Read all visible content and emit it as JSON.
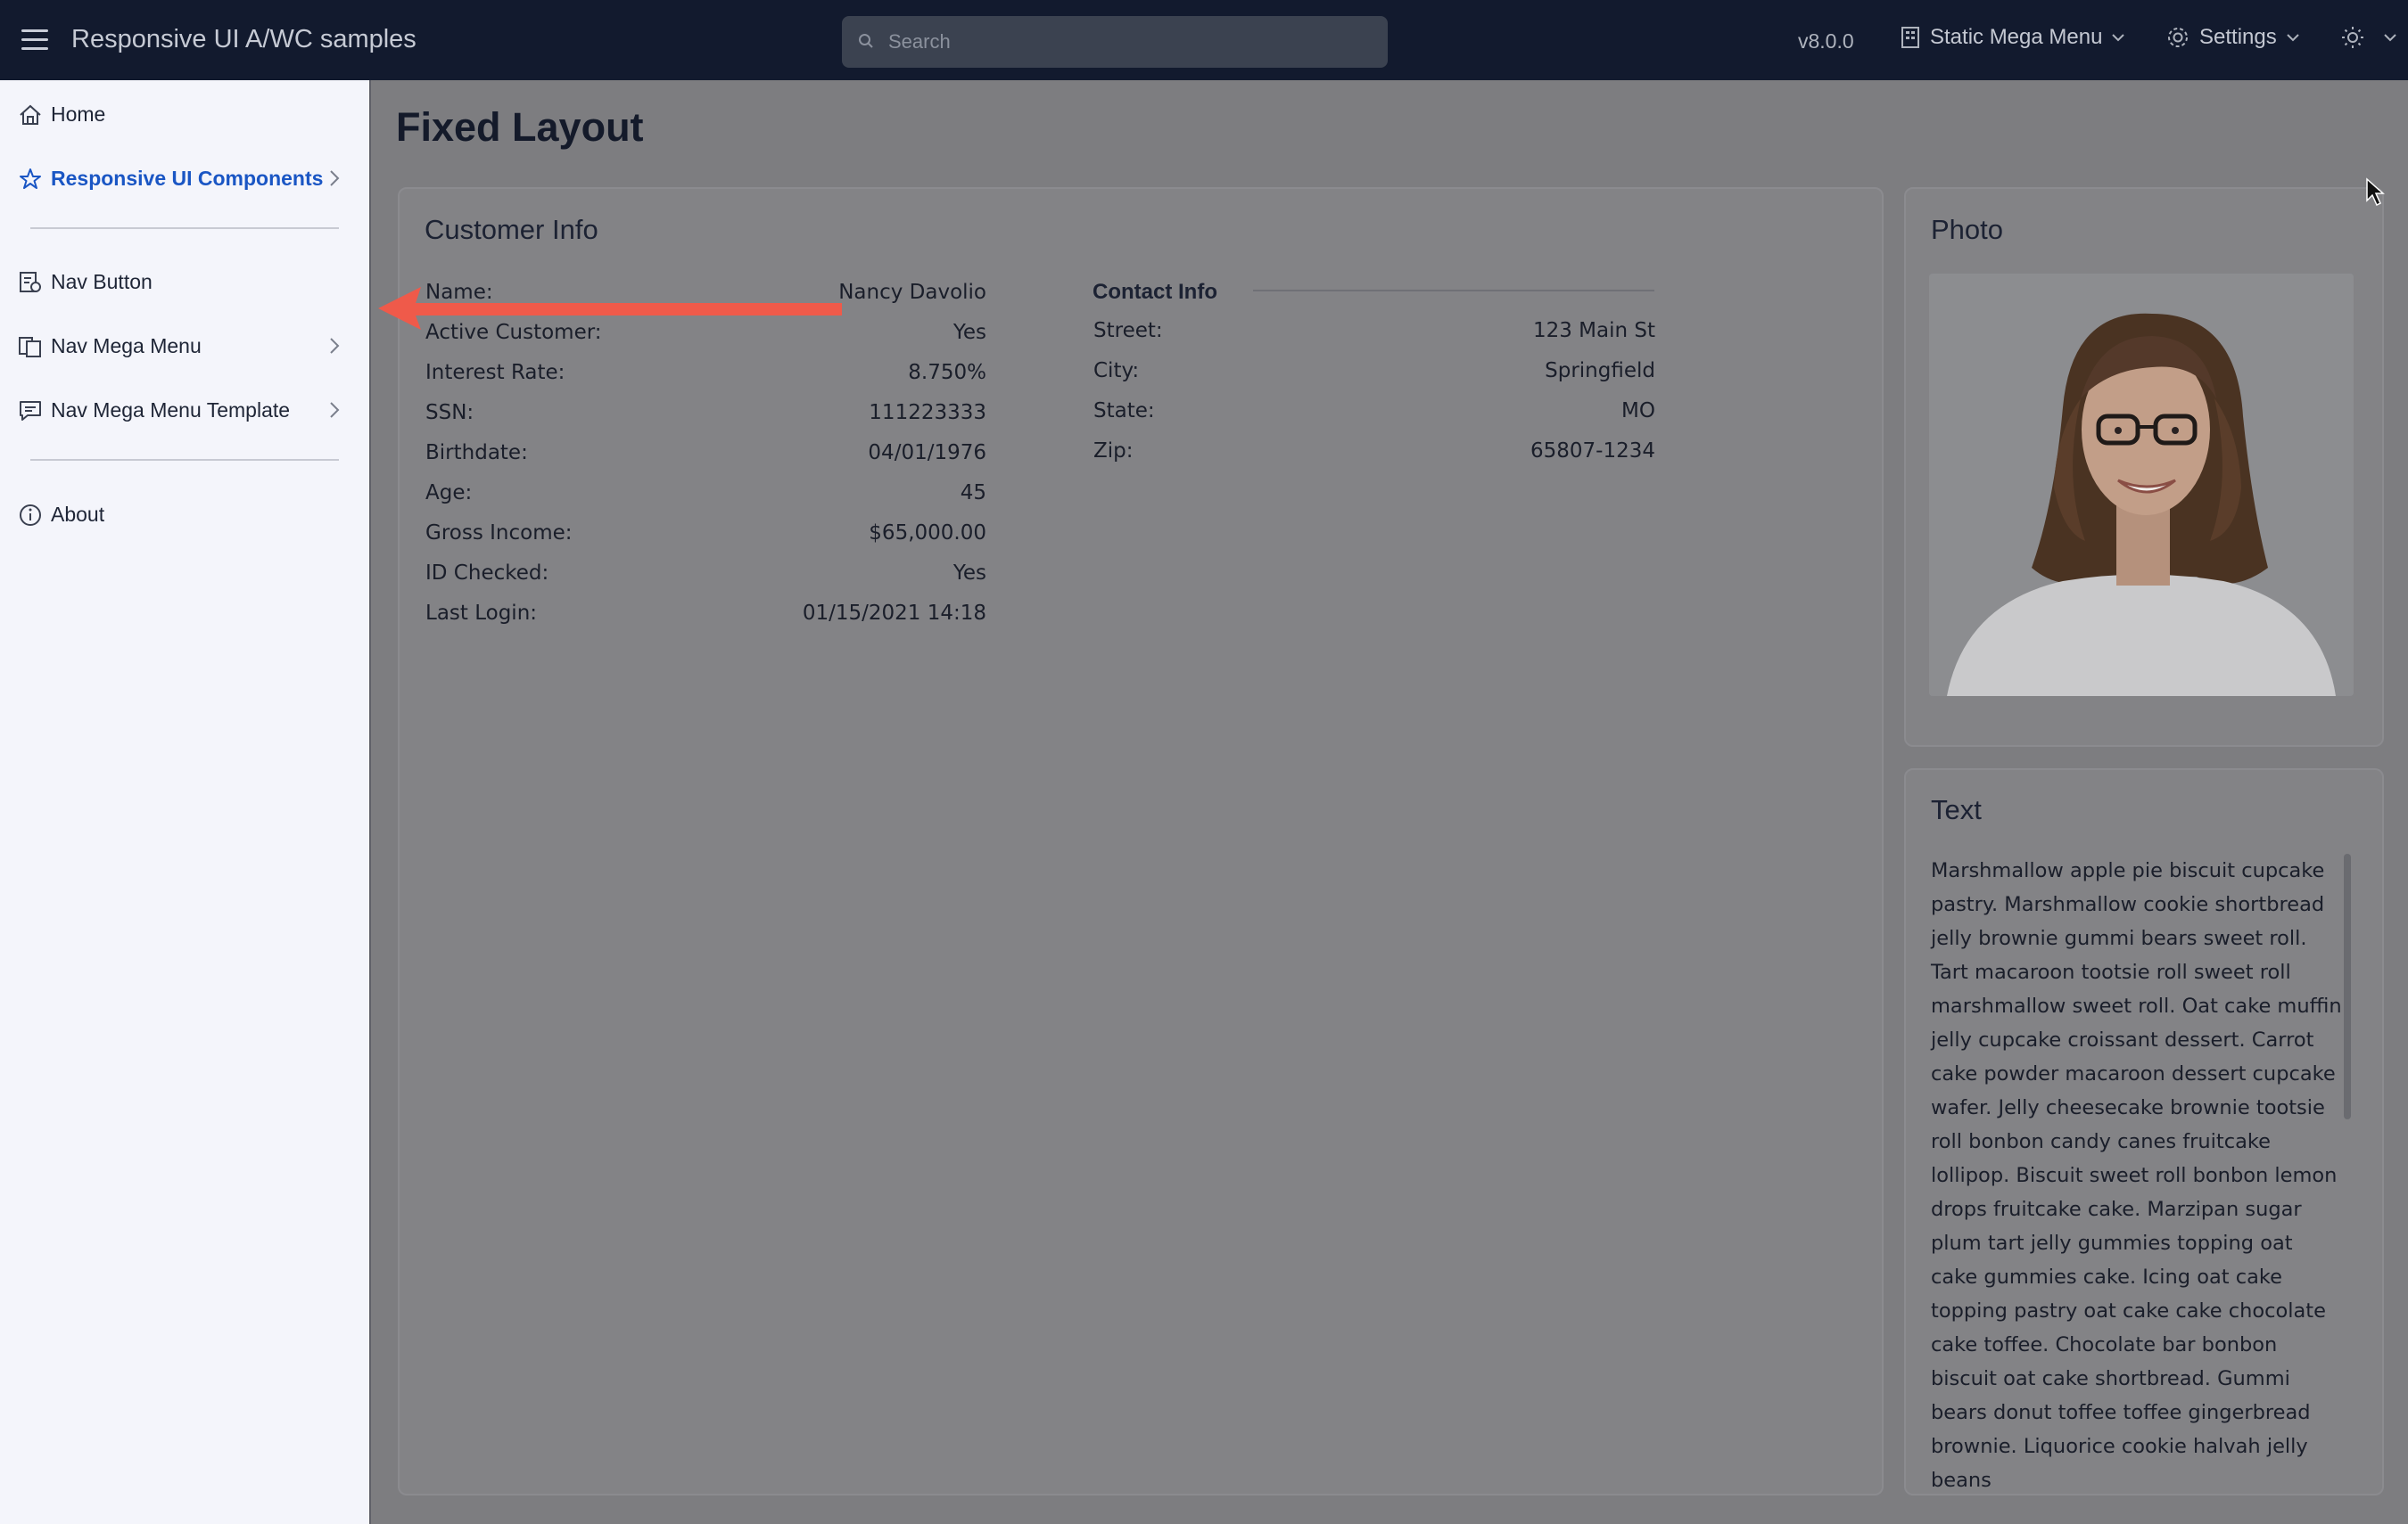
{
  "topbar": {
    "app_title": "Responsive UI A/WC samples",
    "search_placeholder": "Search",
    "version": "v8.0.0",
    "mega_menu_label": "Static Mega Menu",
    "settings_label": "Settings"
  },
  "sidebar": {
    "items": [
      {
        "label": "Home",
        "icon": "home-icon"
      },
      {
        "label": "Responsive UI Components",
        "icon": "star-icon",
        "active": true
      },
      {
        "label": "Nav Button",
        "icon": "nav-button-icon"
      },
      {
        "label": "Nav Mega Menu",
        "icon": "mega-menu-icon"
      },
      {
        "label": "Nav Mega Menu Template",
        "icon": "chat-icon"
      },
      {
        "label": "About",
        "icon": "info-icon"
      }
    ]
  },
  "page": {
    "title": "Fixed Layout"
  },
  "customer_info": {
    "title": "Customer Info",
    "rows": [
      {
        "label": "Name:",
        "value": "Nancy Davolio"
      },
      {
        "label": "Active Customer:",
        "value": "Yes"
      },
      {
        "label": "Interest Rate:",
        "value": "8.750%"
      },
      {
        "label": "SSN:",
        "value": "111223333"
      },
      {
        "label": "Birthdate:",
        "value": "04/01/1976"
      },
      {
        "label": "Age:",
        "value": "45"
      },
      {
        "label": "Gross Income:",
        "value": "$65,000.00"
      },
      {
        "label": "ID Checked:",
        "value": "Yes"
      },
      {
        "label": "Last Login:",
        "value": "01/15/2021 14:18"
      }
    ],
    "contact_title": "Contact Info",
    "contact_rows": [
      {
        "label": "Street:",
        "value": "123 Main St"
      },
      {
        "label": "City:",
        "value": "Springfield"
      },
      {
        "label": "State:",
        "value": "MO"
      },
      {
        "label": "Zip:",
        "value": "65807-1234"
      }
    ]
  },
  "photo_card": {
    "title": "Photo"
  },
  "text_card": {
    "title": "Text",
    "body": "Marshmallow apple pie biscuit cupcake pastry. Marshmallow cookie shortbread jelly brownie gummi bears sweet roll. Tart macaroon tootsie roll sweet roll marshmallow sweet roll. Oat cake muffin jelly cupcake croissant dessert. Carrot cake powder macaroon dessert cupcake wafer. Jelly cheesecake brownie tootsie roll bonbon candy canes fruitcake lollipop. Biscuit sweet roll bonbon lemon drops fruitcake cake. Marzipan sugar plum tart jelly gummies topping oat cake gummies cake. Icing oat cake topping pastry oat cake cake chocolate cake toffee. Chocolate bar bonbon biscuit oat cake shortbread. Gummi bears donut toffee toffee gingerbread brownie. Liquorice cookie halvah jelly beans"
  },
  "colors": {
    "topbar_bg": "#121a2e",
    "sidebar_bg": "#f4f5fb",
    "overlay_bg": "#7d7d80",
    "active_nav": "#1a56c4",
    "annotation_arrow": "#ef5a4a"
  }
}
